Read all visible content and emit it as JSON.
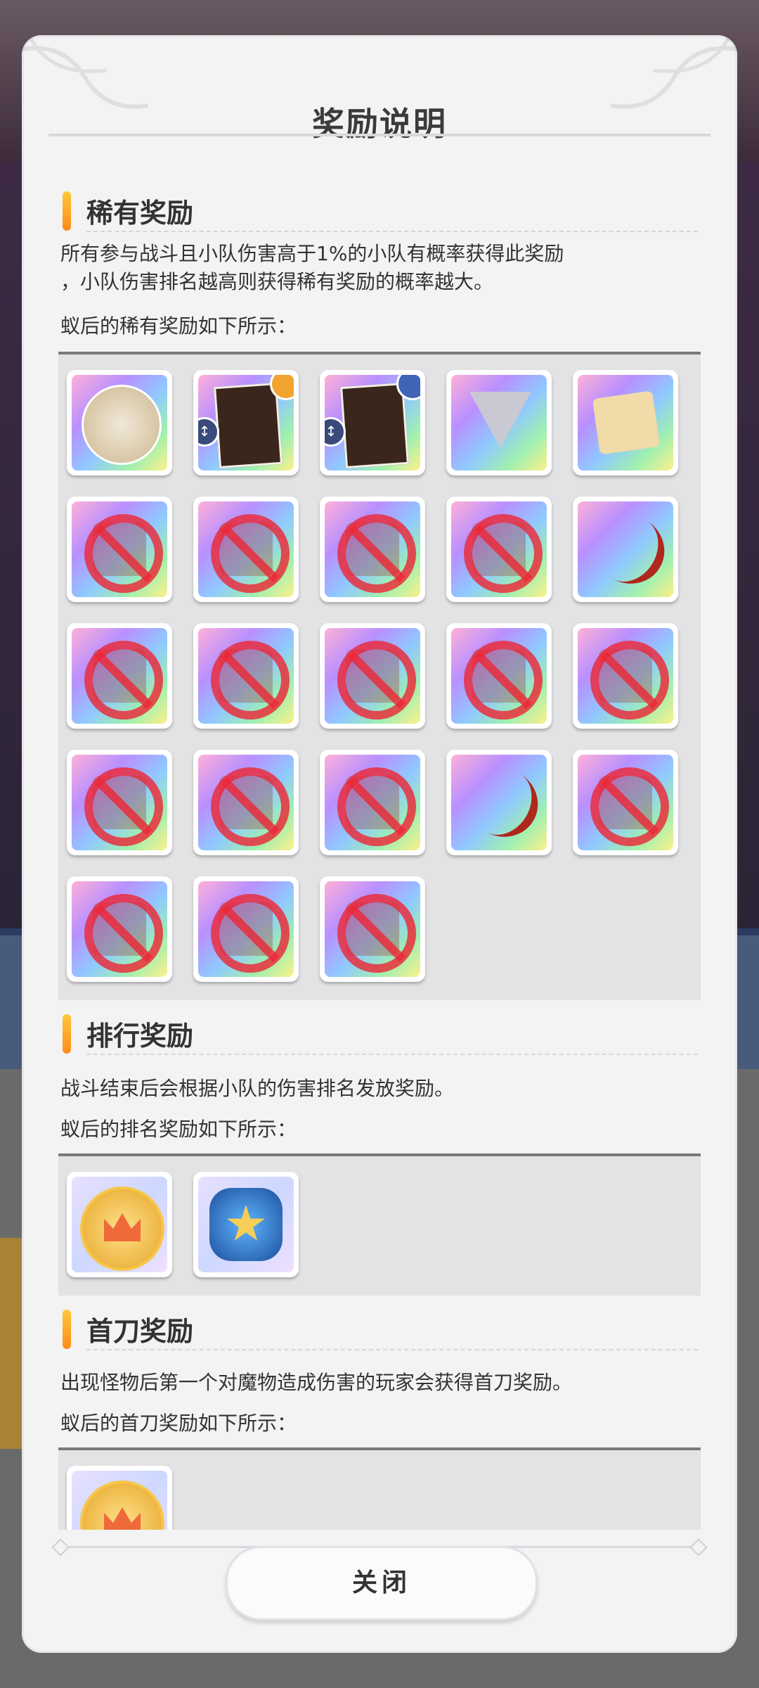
{
  "modal": {
    "title": "奖励说明",
    "close_label": "关闭"
  },
  "sections": {
    "rare": {
      "title": "稀有奖励",
      "desc_line1": "所有参与战斗且小队伤害高于1%的小队有概率获得此奖励",
      "desc_line2": "，小队伤害排名越高则获得稀有奖励的概率越大。",
      "list_caption": "蚁后的稀有奖励如下所示："
    },
    "rank": {
      "title": "排行奖励",
      "desc": "战斗结束后会根据小队的伤害排名发放奖励。",
      "list_caption": "蚁后的排名奖励如下所示："
    },
    "first": {
      "title": "首刀奖励",
      "desc": "出现怪物后第一个对魔物造成伤害的玩家会获得首刀奖励。",
      "list_caption": "蚁后的首刀奖励如下所示："
    }
  },
  "rare_items": [
    "character-portrait-icon",
    "character-card-sun-icon",
    "character-card-moon-icon",
    "crystal-triangle-icon",
    "treasure-map-icon",
    "banned-spear-icon",
    "banned-armor-icon",
    "banned-gauntlet-icon",
    "banned-shield-icon",
    "bow-icon",
    "banned-staff-icon",
    "banned-book-icon",
    "banned-shield-icon",
    "banned-claw-icon",
    "banned-spear-icon",
    "banned-armor-icon",
    "banned-gauntlet-icon",
    "banned-shield-icon",
    "bow-icon",
    "banned-staff-icon",
    "banned-book-icon",
    "banned-shield-icon",
    "banned-claw-icon"
  ],
  "rank_items": [
    "crown-coin-icon",
    "blue-emblem-icon"
  ],
  "first_items": [
    "crown-coin-icon"
  ]
}
